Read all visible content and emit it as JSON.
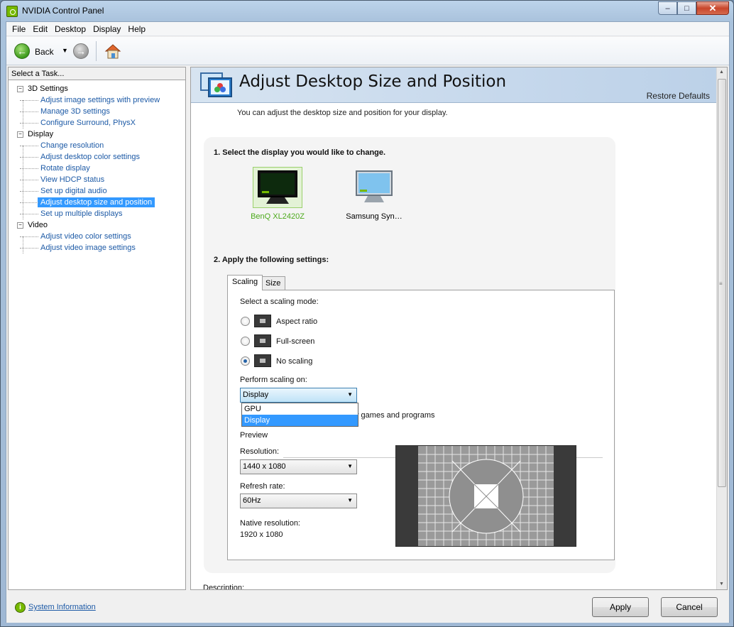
{
  "window": {
    "title": "NVIDIA Control Panel",
    "minimize": "–",
    "maximize": "□",
    "close": "✕"
  },
  "menu": [
    "File",
    "Edit",
    "Desktop",
    "Display",
    "Help"
  ],
  "toolbar": {
    "back_label": "Back"
  },
  "left": {
    "header": "Select a Task...",
    "groups": [
      {
        "label": "3D Settings",
        "items": [
          "Adjust image settings with preview",
          "Manage 3D settings",
          "Configure Surround, PhysX"
        ]
      },
      {
        "label": "Display",
        "items": [
          "Change resolution",
          "Adjust desktop color settings",
          "Rotate display",
          "View HDCP status",
          "Set up digital audio",
          "Adjust desktop size and position",
          "Set up multiple displays"
        ]
      },
      {
        "label": "Video",
        "items": [
          "Adjust video color settings",
          "Adjust video image settings"
        ]
      }
    ],
    "selected_item": "Adjust desktop size and position"
  },
  "page": {
    "title": "Adjust Desktop Size and Position",
    "restore_defaults": "Restore Defaults",
    "description": "You can adjust the desktop size and position for your display.",
    "step1": "1. Select the display you would like to change.",
    "displays": [
      {
        "name": "BenQ XL2420Z",
        "selected": true
      },
      {
        "name": "Samsung Syn…",
        "selected": false
      }
    ],
    "step2": "2. Apply the following settings:",
    "tabs": [
      "Scaling",
      "Size"
    ],
    "scaling_mode_label": "Select a scaling mode:",
    "modes": [
      "Aspect ratio",
      "Full-screen",
      "No scaling"
    ],
    "selected_mode": "No scaling",
    "perform_on_label": "Perform scaling on:",
    "perform_on_value": "Display",
    "perform_on_options": [
      "GPU",
      "Display"
    ],
    "override_text": "y games and programs",
    "preview_label": "Preview",
    "resolution_label": "Resolution:",
    "resolution_value": "1440 x 1080",
    "refresh_label": "Refresh rate:",
    "refresh_value": "60Hz",
    "native_label": "Native resolution:",
    "native_value": "1920 x 1080",
    "cutoff_label": "Description:"
  },
  "footer": {
    "sysinfo": "System Information",
    "apply": "Apply",
    "cancel": "Cancel"
  },
  "colors": {
    "nvidia_green": "#76b900",
    "selection_blue": "#3399ff",
    "link_blue": "#1d5aa6"
  }
}
